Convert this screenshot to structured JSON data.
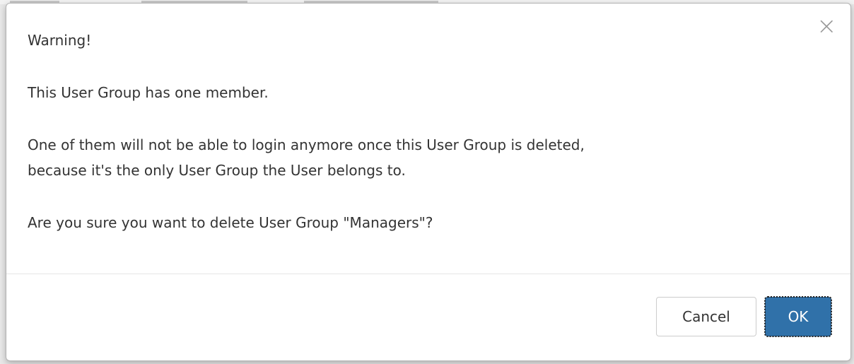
{
  "dialog": {
    "title": "Warning!",
    "close_glyph": "×",
    "close_icon": "close-icon",
    "message_1": "This User Group has one member.",
    "message_2_line_1": "One of them will not be able to login anymore once this User Group is deleted,",
    "message_2_line_2": "because it's the only User Group the User belongs to.",
    "message_3": "Are you sure you want to delete User Group \"Managers\"?",
    "cancel_label": "Cancel",
    "ok_label": "OK"
  },
  "colors": {
    "primary_button": "#3071a9",
    "text": "#333333",
    "close_icon": "#9a9a9a"
  }
}
